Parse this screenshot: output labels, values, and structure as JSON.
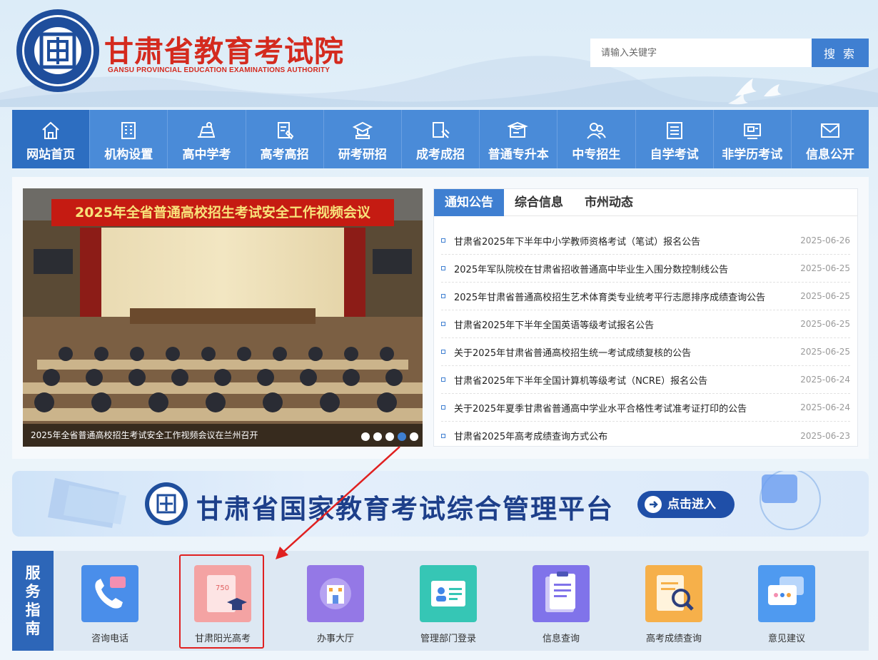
{
  "header": {
    "title": "甘肃省教育考试院",
    "subtitle": "GANSU PROVINCIAL EDUCATION EXAMINATIONS AUTHORITY",
    "search_placeholder": "请输入关键字",
    "search_label": "搜 索",
    "emblem_char": "回"
  },
  "nav": {
    "items": [
      {
        "label": "网站首页",
        "icon": "home-icon"
      },
      {
        "label": "机构设置",
        "icon": "building-icon"
      },
      {
        "label": "高中学考",
        "icon": "books-icon"
      },
      {
        "label": "高考高招",
        "icon": "pen-paper-icon"
      },
      {
        "label": "研考研招",
        "icon": "graduation-icon"
      },
      {
        "label": "成考成招",
        "icon": "tablet-pen-icon"
      },
      {
        "label": "普通专升本",
        "icon": "screen-cap-icon"
      },
      {
        "label": "中专招生",
        "icon": "people-icon"
      },
      {
        "label": "自学考试",
        "icon": "list-icon"
      },
      {
        "label": "非学历考试",
        "icon": "certificate-icon"
      },
      {
        "label": "信息公开",
        "icon": "mail-icon"
      }
    ]
  },
  "slide": {
    "banner_text": "2025年全省普通高校招生考试安全工作视频会议",
    "caption": "2025年全省普通高校招生考试安全工作视频会议在兰州召开"
  },
  "news": {
    "tabs": [
      "通知公告",
      "综合信息",
      "市州动态"
    ],
    "items": [
      {
        "title": "甘肃省2025年下半年中小学教师资格考试（笔试）报名公告",
        "date": "2025-06-26"
      },
      {
        "title": "2025年军队院校在甘肃省招收普通高中毕业生入围分数控制线公告",
        "date": "2025-06-25"
      },
      {
        "title": "2025年甘肃省普通高校招生艺术体育类专业统考平行志愿排序成绩查询公告",
        "date": "2025-06-25"
      },
      {
        "title": "甘肃省2025年下半年全国英语等级考试报名公告",
        "date": "2025-06-25"
      },
      {
        "title": "关于2025年甘肃省普通高校招生统一考试成绩复核的公告",
        "date": "2025-06-25"
      },
      {
        "title": "甘肃省2025年下半年全国计算机等级考试（NCRE）报名公告",
        "date": "2025-06-24"
      },
      {
        "title": "关于2025年夏季甘肃省普通高中学业水平合格性考试准考证打印的公告",
        "date": "2025-06-24"
      },
      {
        "title": "甘肃省2025年高考成绩查询方式公布",
        "date": "2025-06-23"
      }
    ]
  },
  "platform_banner": {
    "title": "甘肃省国家教育考试综合管理平台",
    "button": "点击进入"
  },
  "service": {
    "label_chars": [
      "服",
      "务",
      "指",
      "南"
    ],
    "items": [
      {
        "label": "咨询电话",
        "icon": "phone-chat-icon",
        "color": "#3f86e8"
      },
      {
        "label": "甘肃阳光高考",
        "icon": "score-cap-icon",
        "color": "#f08a8a",
        "badge": "750"
      },
      {
        "label": "办事大厅",
        "icon": "hall-icon",
        "color": "#8d6fe0"
      },
      {
        "label": "管理部门登录",
        "icon": "id-card-icon",
        "color": "#2fbfb0"
      },
      {
        "label": "信息查询",
        "icon": "clipboard-icon",
        "color": "#7b6fe6"
      },
      {
        "label": "高考成绩查询",
        "icon": "magnifier-doc-icon",
        "color": "#f4a23b"
      },
      {
        "label": "意见建议",
        "icon": "chat-bubbles-icon",
        "color": "#3f8ff0"
      }
    ]
  },
  "colors": {
    "brand_red": "#d42a1e",
    "nav_blue": "#4a8bd8",
    "nav_active": "#2d6ec1",
    "accent_blue": "#3f7fd1",
    "highlight_red": "#e02020"
  }
}
